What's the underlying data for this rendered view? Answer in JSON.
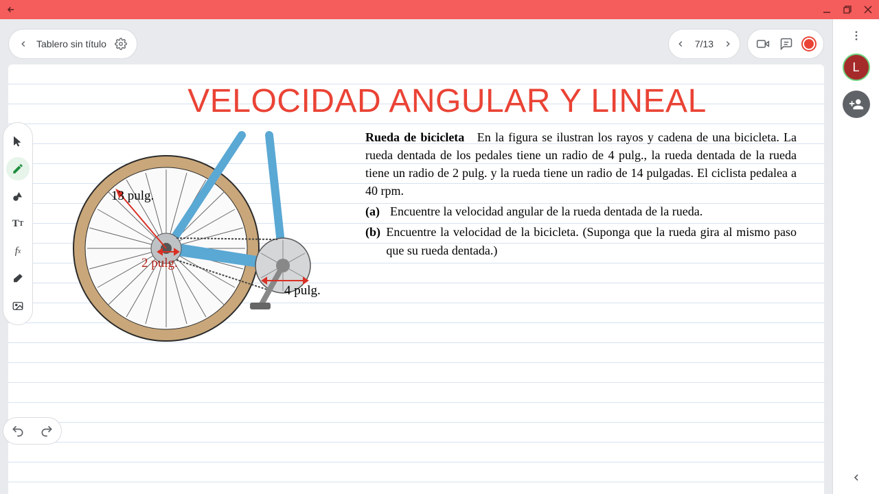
{
  "titlebar": {
    "minimize": "—",
    "restore": "❐",
    "close": "✕",
    "back": "←"
  },
  "board": {
    "title": "Tablero sin título"
  },
  "pager": {
    "label": "7/13"
  },
  "content": {
    "heading": "VELOCIDAD ANGULAR Y LINEAL",
    "problem_title": "Rueda de bicicleta",
    "problem_body": "En la figura se ilustran los rayos y cadena de una bicicleta. La rueda dentada de los pedales tiene un radio de 4 pulg., la rueda dentada de la rueda tiene un radio de 2 pulg. y la rueda tiene un radio de 14 pulgadas. El ciclista pedalea a 40 rpm.",
    "questions": [
      {
        "label": "(a)",
        "text": "Encuentre la velocidad angular de la rueda dentada de la rueda."
      },
      {
        "label": "(b)",
        "text": "Encuentre la velocidad de la bicicleta. (Suponga que la rueda gira al mismo paso que su rueda dentada.)"
      }
    ],
    "diagram_labels": {
      "wheel_radius": "13 pulg.",
      "rear_gear": "2 pulg.",
      "front_gear": "4 pulg."
    }
  },
  "sidebar": {
    "avatar_letter": "L"
  }
}
